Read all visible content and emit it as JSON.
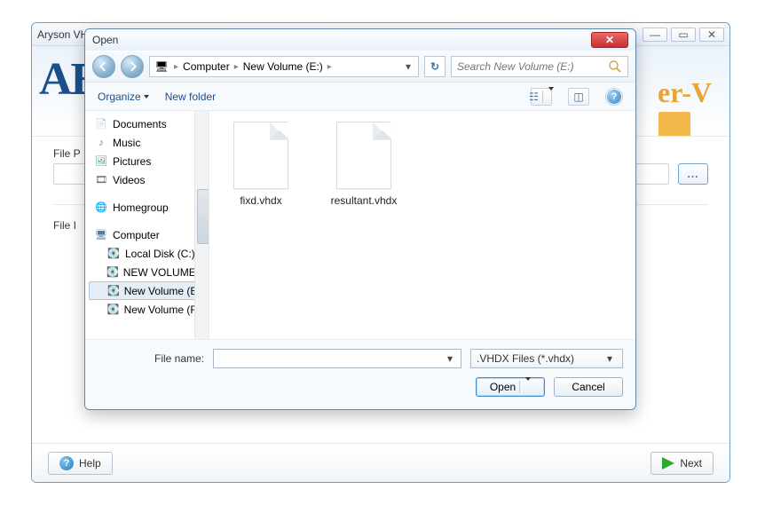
{
  "app": {
    "title_partial": "Aryson VH",
    "banner_logo_partial": "AE",
    "banner_suffix_partial": "er-V",
    "section_file_path_label_partial": "File P",
    "section_file_info_label_partial": "File I",
    "browse_button_label": "...",
    "help_label": "Help",
    "next_label": "Next",
    "win_min": "—",
    "win_max": "▭",
    "win_close": "✕"
  },
  "dialog": {
    "title": "Open",
    "close_glyph": "✕",
    "breadcrumb": {
      "root": "Computer",
      "current": "New Volume (E:)"
    },
    "search_placeholder": "Search New Volume (E:)",
    "toolbar": {
      "organize": "Organize",
      "new_folder": "New folder"
    },
    "tree": [
      {
        "label": "Documents",
        "icon": "docs",
        "indent": 0
      },
      {
        "label": "Music",
        "icon": "music",
        "indent": 0
      },
      {
        "label": "Pictures",
        "icon": "pics",
        "indent": 0
      },
      {
        "label": "Videos",
        "icon": "vid",
        "indent": 0
      },
      {
        "label": "",
        "icon": "",
        "indent": 0
      },
      {
        "label": "Homegroup",
        "icon": "home",
        "indent": 0
      },
      {
        "label": "",
        "icon": "",
        "indent": 0
      },
      {
        "label": "Computer",
        "icon": "comp",
        "indent": 0
      },
      {
        "label": "Local Disk (C:)",
        "icon": "disk",
        "indent": 1
      },
      {
        "label": "NEW VOLUME (D",
        "icon": "disk",
        "indent": 1
      },
      {
        "label": "New Volume (E:)",
        "icon": "disk",
        "indent": 1,
        "selected": true
      },
      {
        "label": "New Volume (F:)",
        "icon": "disk",
        "indent": 1
      }
    ],
    "files": [
      {
        "name": "fixd.vhdx"
      },
      {
        "name": "resultant.vhdx"
      }
    ],
    "file_name_label": "File name:",
    "file_name_value": "",
    "filter_label": ".VHDX Files (*.vhdx)",
    "open_button": "Open",
    "cancel_button": "Cancel"
  }
}
